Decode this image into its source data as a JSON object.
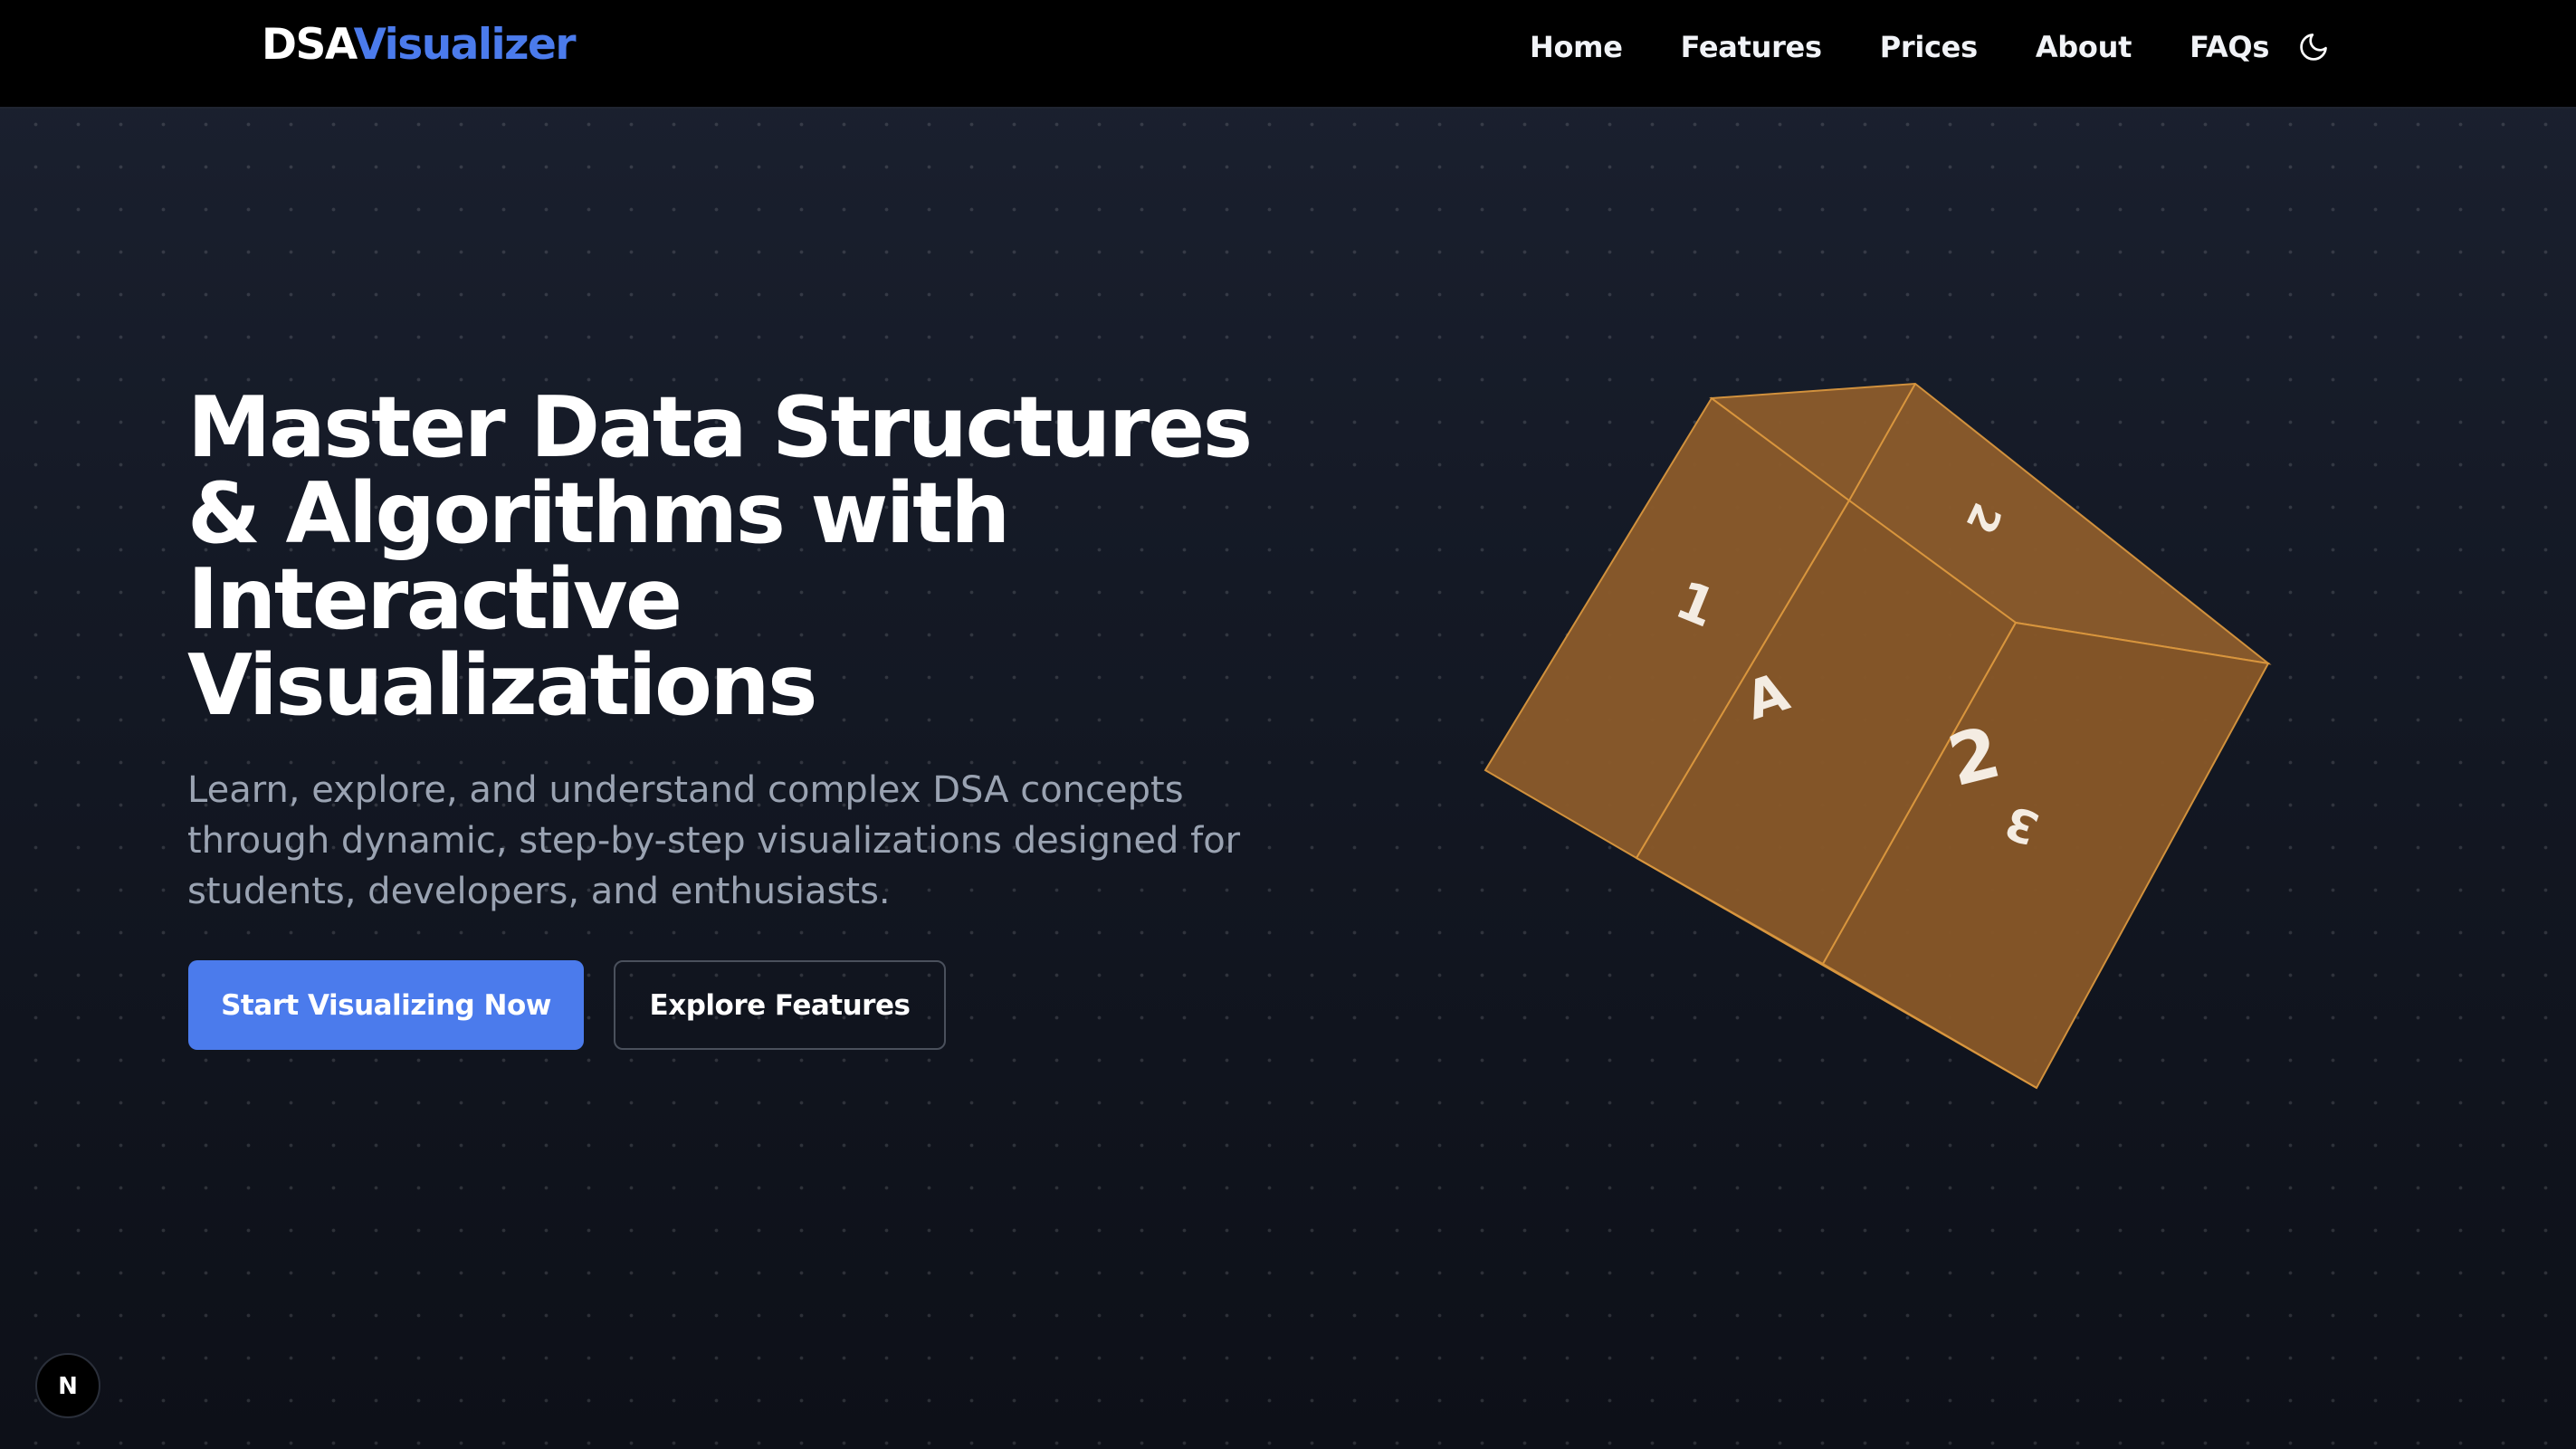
{
  "brand": {
    "part1": "DSA",
    "part2": "Visualizer",
    "part1_color": "#ffffff",
    "part2_color": "#4b7bec"
  },
  "nav": {
    "items": [
      {
        "label": "Home"
      },
      {
        "label": "Features"
      },
      {
        "label": "Prices"
      },
      {
        "label": "About"
      },
      {
        "label": "FAQs"
      }
    ],
    "theme_toggle_icon": "moon-icon"
  },
  "hero": {
    "title_lines": [
      "Master Data Structures",
      "& Algorithms with",
      "Interactive",
      "Visualizations"
    ],
    "subtitle_lines": [
      "Learn, explore, and understand complex DSA concepts",
      "through dynamic, step-by-step visualizations designed for",
      "students, developers, and enthusiasts."
    ],
    "primary_button": "Start Visualizing Now",
    "secondary_button": "Explore Features",
    "accent_color": "#4b7bec"
  },
  "cube": {
    "face_color": "#8a5a2b",
    "edge_color": "#d9963e",
    "labels": [
      "1",
      "A",
      "2",
      "2",
      "3"
    ]
  },
  "badge": {
    "letter": "N"
  }
}
